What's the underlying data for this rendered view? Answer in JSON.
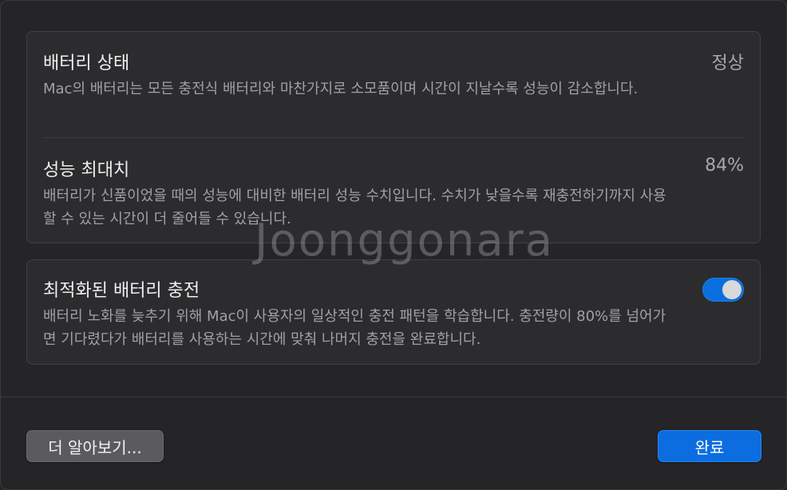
{
  "battery_health": {
    "title": "배터리 상태",
    "value": "정상",
    "description": "Mac의 배터리는 모든 충전식 배터리와 마찬가지로 소모품이며 시간이 지날수록 성능이 감소합니다."
  },
  "max_capacity": {
    "title": "성능 최대치",
    "value": "84%",
    "description": "배터리가 신품이었을 때의 성능에 대비한 배터리 성능 수치입니다. 수치가 낮을수록 재충전하기까지 사용할 수 있는 시간이 더 줄어들 수 있습니다."
  },
  "optimized_charging": {
    "title": "최적화된 배터리 충전",
    "enabled": true,
    "description": "배터리 노화를 늦추기 위해 Mac이 사용자의 일상적인 충전 패턴을 학습합니다. 충전량이 80%를 넘어가면 기다렸다가 배터리를 사용하는 시간에 맞춰 나머지 충전을 완료합니다."
  },
  "watermark": "Joonggonara",
  "footer": {
    "learn_more_label": "더 알아보기...",
    "done_label": "완료"
  },
  "colors": {
    "accent": "#0b6de0",
    "background": "#252527",
    "card": "#2c2c2e"
  }
}
